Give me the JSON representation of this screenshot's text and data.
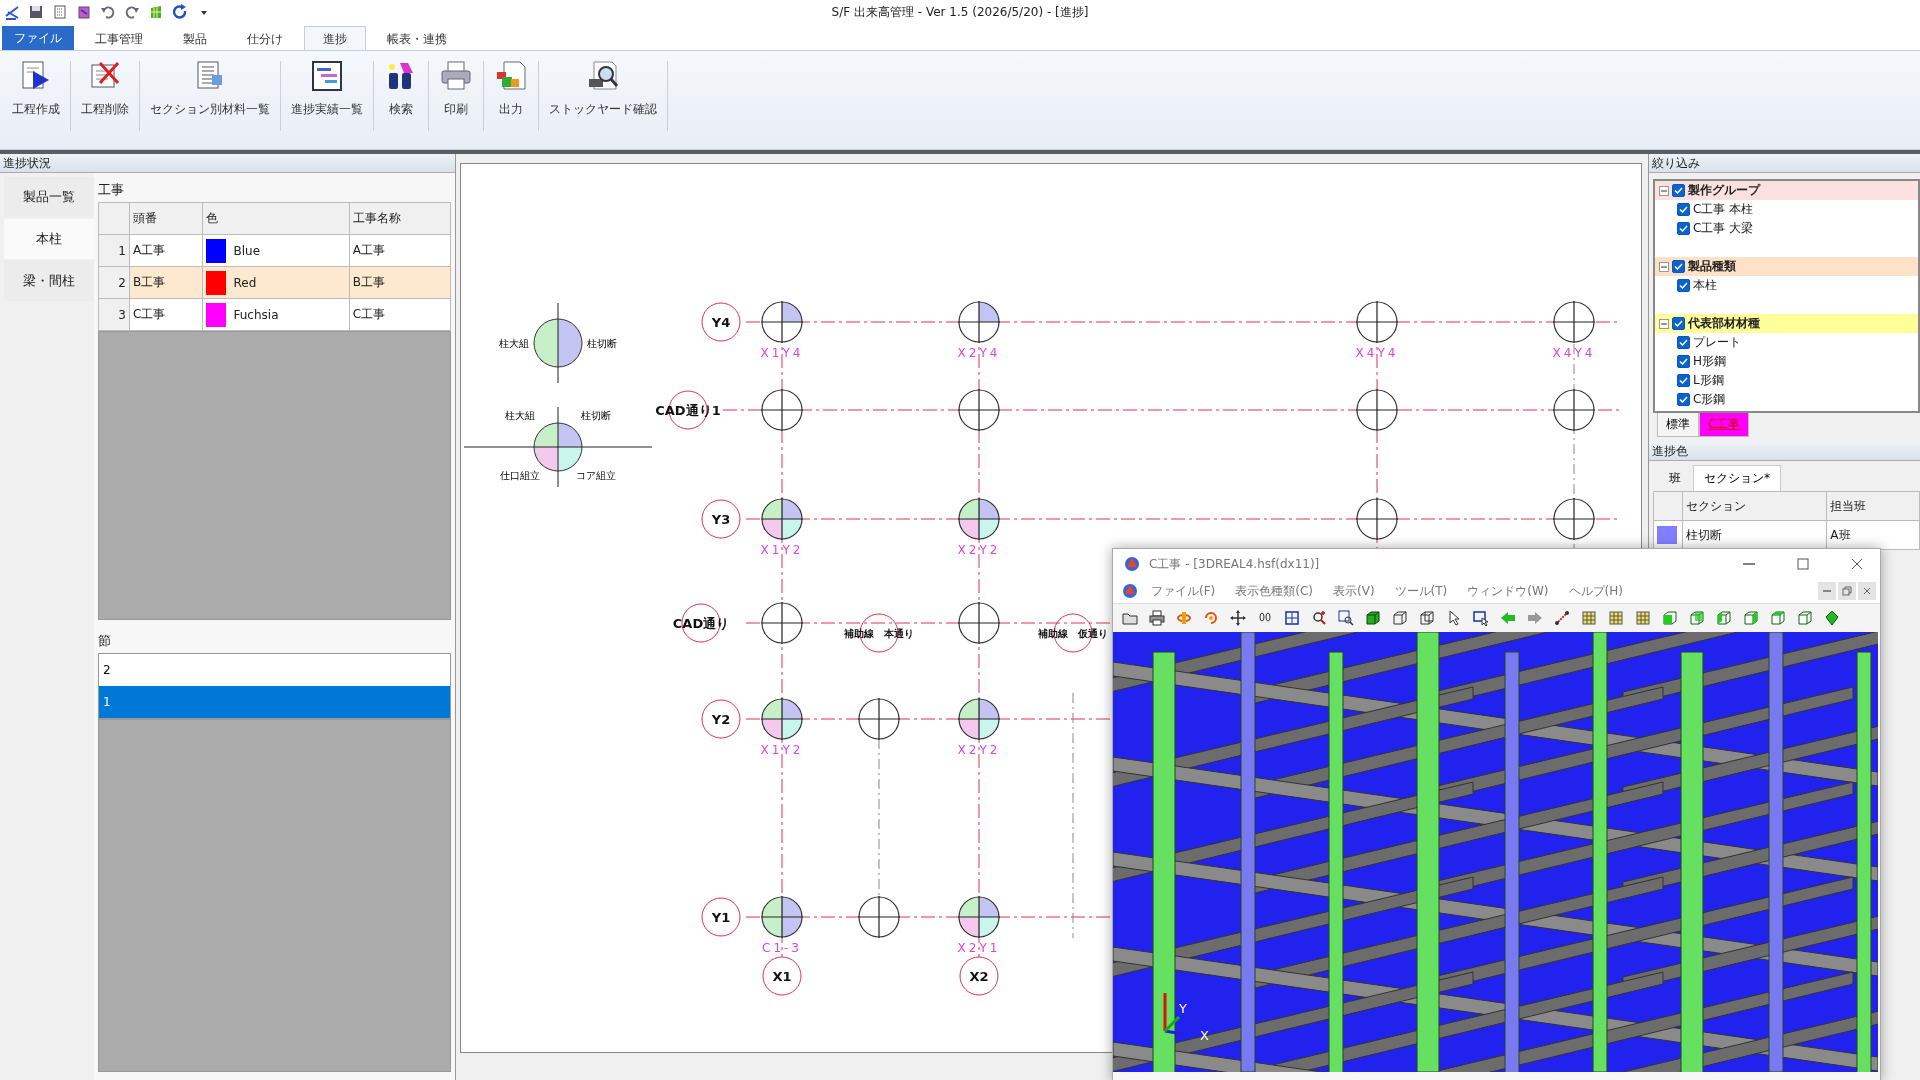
{
  "app": {
    "title": "S/F 出来高管理 - Ver 1.5 (2026/5/20) - [進捗]"
  },
  "ribbon": {
    "file_tab": "ファイル",
    "tabs": [
      {
        "label": "工事管理",
        "selected": false
      },
      {
        "label": "製品",
        "selected": false
      },
      {
        "label": "仕分け",
        "selected": false
      },
      {
        "label": "進捗",
        "selected": true
      },
      {
        "label": "帳表・連携",
        "selected": false
      }
    ],
    "buttons": [
      "工程作成",
      "工程削除",
      "セクション別材料一覧",
      "進捗実績一覧",
      "検索",
      "印刷",
      "出力",
      "ストックヤード確認"
    ]
  },
  "left_panel": {
    "title": "進捗状況",
    "tabs": [
      {
        "label": "製品一覧",
        "selected": false
      },
      {
        "label": "本柱",
        "selected": true
      },
      {
        "label": "梁・間柱",
        "selected": false
      }
    ],
    "works": {
      "caption": "工事",
      "columns": [
        "頭番",
        "色",
        "工事名称"
      ],
      "rows": [
        {
          "no": "1",
          "code": "A工事",
          "color": "#0000ff",
          "color_name": "Blue",
          "name": "A工事",
          "selected": false
        },
        {
          "no": "2",
          "code": "B工事",
          "color": "#ff0000",
          "color_name": "Red",
          "name": "B工事",
          "selected": true
        },
        {
          "no": "3",
          "code": "C工事",
          "color": "#ff00ff",
          "color_name": "Fuchsia",
          "name": "C工事",
          "selected": false
        }
      ]
    },
    "sections": {
      "caption": "節",
      "items": [
        {
          "label": "2",
          "selected": false
        },
        {
          "label": "1",
          "selected": true
        }
      ]
    }
  },
  "canvas": {
    "legend": [
      {
        "kind": "half",
        "labels": [
          "柱大組",
          "柱切断"
        ]
      },
      {
        "kind": "quad",
        "labels": [
          "柱大組",
          "柱切断",
          "仕口組立",
          "コア組立"
        ]
      }
    ],
    "rows": [
      {
        "label": "Y4",
        "cells": [
          {
            "kind": "quad",
            "tag": "X1Y4",
            "assembled": false,
            "cut": true,
            "joint": false,
            "core": false
          },
          {
            "kind": "blank"
          },
          {
            "kind": "quad",
            "tag": "X2Y4",
            "assembled": false,
            "cut": true,
            "joint": false,
            "core": false
          },
          {
            "kind": "blank"
          },
          {
            "kind": "quad",
            "tag": "X4Y4",
            "assembled": false,
            "cut": false,
            "joint": false,
            "core": false
          },
          {
            "kind": "quad",
            "tag": "X4Y4",
            "assembled": false,
            "cut": false,
            "joint": false,
            "core": false
          }
        ]
      },
      {
        "label": "CAD通り1",
        "cells": [
          {
            "kind": "quad",
            "assembled": false,
            "cut": false,
            "joint": false,
            "core": false
          },
          {
            "kind": "blank"
          },
          {
            "kind": "quad",
            "assembled": false,
            "cut": false,
            "joint": false,
            "core": false
          },
          {
            "kind": "blank"
          },
          {
            "kind": "quad",
            "assembled": false,
            "cut": false,
            "joint": false,
            "core": false
          },
          {
            "kind": "quad",
            "assembled": false,
            "cut": false,
            "joint": false,
            "core": false
          }
        ]
      },
      {
        "label": "Y3",
        "cells": [
          {
            "kind": "quad",
            "tag": "X1Y2",
            "assembled": true,
            "cut": true,
            "joint": true,
            "core": true
          },
          {
            "kind": "blank"
          },
          {
            "kind": "quad",
            "tag": "X2Y2",
            "assembled": true,
            "cut": true,
            "joint": true,
            "core": true
          },
          {
            "kind": "blank"
          },
          {
            "kind": "quad",
            "assembled": false,
            "cut": false,
            "joint": false,
            "core": false
          },
          {
            "kind": "quad",
            "assembled": false,
            "cut": false,
            "joint": false,
            "core": false
          }
        ]
      },
      {
        "label": "CAD通り",
        "cells": [
          {
            "kind": "quad",
            "assembled": false,
            "cut": false,
            "joint": false,
            "core": false
          },
          {
            "kind": "aux",
            "text": "補助線　本通り"
          },
          {
            "kind": "quad",
            "assembled": false,
            "cut": false,
            "joint": false,
            "core": false
          },
          {
            "kind": "aux",
            "text": "補助線　仮通り"
          }
        ]
      },
      {
        "label": "Y2",
        "cells": [
          {
            "kind": "quad",
            "tag": "X1Y2",
            "assembled": true,
            "cut": true,
            "joint": true,
            "core": true
          },
          {
            "kind": "quad",
            "assembled": false,
            "cut": false,
            "joint": false,
            "core": false
          },
          {
            "kind": "quad",
            "tag": "X2Y2",
            "assembled": true,
            "cut": true,
            "joint": true,
            "core": true
          }
        ]
      },
      {
        "label": "Y1",
        "cells": [
          {
            "kind": "half",
            "tag": "C1-3",
            "assembled": true,
            "cut": true
          },
          {
            "kind": "quad",
            "assembled": false,
            "cut": false,
            "joint": false,
            "core": false
          },
          {
            "kind": "quad",
            "tag": "X2Y1",
            "assembled": true,
            "cut": true,
            "joint": true,
            "core": true
          }
        ]
      }
    ],
    "column_labels": [
      {
        "kind": "label",
        "text": "X1"
      },
      {
        "kind": "blank"
      },
      {
        "kind": "label",
        "text": "X2"
      }
    ]
  },
  "filter": {
    "title": "絞り込み",
    "groups": [
      {
        "label": "製作グループ",
        "color": "#fde0e0",
        "checked": true,
        "expanded": true,
        "children": [
          {
            "label": "C工事 本柱",
            "checked": true
          },
          {
            "label": "C工事 大梁",
            "checked": true
          }
        ]
      },
      {
        "label": "製品種類",
        "color": "#fde2c8",
        "checked": true,
        "expanded": true,
        "children": [
          {
            "label": "本柱",
            "checked": true
          }
        ]
      },
      {
        "label": "代表部材材種",
        "color": "#ffff99",
        "checked": true,
        "expanded": true,
        "children": [
          {
            "label": "プレート",
            "checked": true
          },
          {
            "label": "H形鋼",
            "checked": true
          },
          {
            "label": "L形鋼",
            "checked": true
          },
          {
            "label": "C形鋼",
            "checked": true
          }
        ]
      }
    ],
    "tabs": [
      {
        "label": "標準",
        "selected": false
      },
      {
        "label": "C工事",
        "selected": true,
        "color": "#ff00ff"
      }
    ]
  },
  "progress_colors": {
    "title": "進捗色",
    "tabs": [
      {
        "label": "班",
        "selected": false
      },
      {
        "label": "セクション*",
        "selected": true
      }
    ],
    "columns": [
      "セクション",
      "担当班"
    ],
    "rows": [
      {
        "color": "#8080ff",
        "section": "柱切断",
        "team": "A班"
      }
    ]
  },
  "viewer": {
    "title": "C工事 - [3DREAL4.hsf(dx11)]",
    "menu": [
      "ファイル(F)",
      "表示色種類(C)",
      "表示(V)",
      "ツール(T)",
      "ウィンドウ(W)",
      "ヘルプ(H)"
    ],
    "axes": [
      "X",
      "Y"
    ]
  }
}
